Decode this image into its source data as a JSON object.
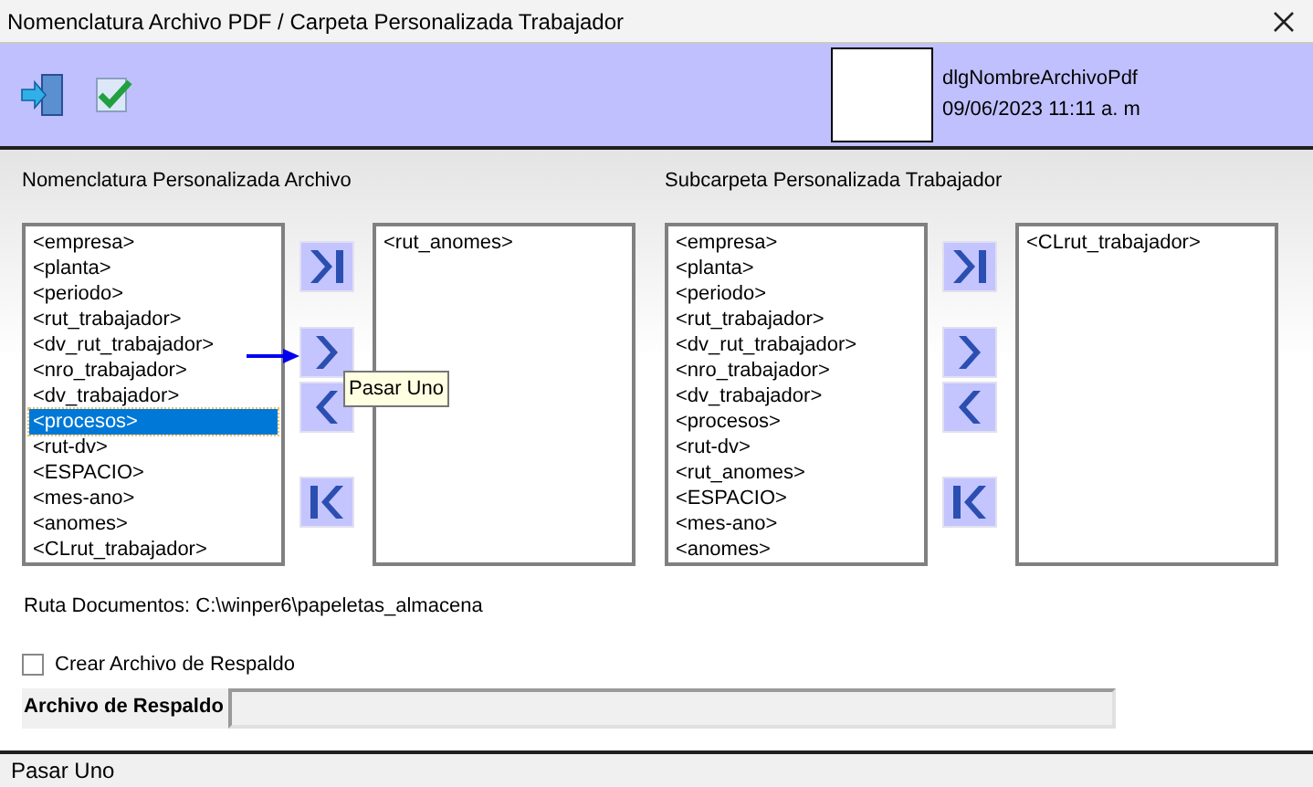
{
  "window": {
    "title": "Nomenclatura Archivo PDF / Carpeta Personalizada Trabajador"
  },
  "header_info": {
    "form_name": "dlgNombreArchivoPdf",
    "timestamp": "09/06/2023 11:11 a. m"
  },
  "groups": [
    {
      "heading": "Nomenclatura Personalizada Archivo",
      "available": [
        {
          "label": "<empresa>",
          "selected": false
        },
        {
          "label": "<planta>",
          "selected": false
        },
        {
          "label": "<periodo>",
          "selected": false
        },
        {
          "label": "<rut_trabajador>",
          "selected": false
        },
        {
          "label": "<dv_rut_trabajador>",
          "selected": false
        },
        {
          "label": "<nro_trabajador>",
          "selected": false
        },
        {
          "label": "<dv_trabajador>",
          "selected": false
        },
        {
          "label": "<procesos>",
          "selected": true
        },
        {
          "label": "<rut-dv>",
          "selected": false
        },
        {
          "label": "<ESPACIO>",
          "selected": false
        },
        {
          "label": "<mes-ano>",
          "selected": false
        },
        {
          "label": "<anomes>",
          "selected": false
        },
        {
          "label": "<CLrut_trabajador>",
          "selected": false
        }
      ],
      "chosen": [
        {
          "label": "<rut_anomes>",
          "selected": false
        }
      ],
      "tooltip": "Pasar Uno"
    },
    {
      "heading": "Subcarpeta Personalizada Trabajador",
      "available": [
        {
          "label": "<empresa>",
          "selected": false
        },
        {
          "label": "<planta>",
          "selected": false
        },
        {
          "label": "<periodo>",
          "selected": false
        },
        {
          "label": "<rut_trabajador>",
          "selected": false
        },
        {
          "label": "<dv_rut_trabajador>",
          "selected": false
        },
        {
          "label": "<nro_trabajador>",
          "selected": false
        },
        {
          "label": "<dv_trabajador>",
          "selected": false
        },
        {
          "label": "<procesos>",
          "selected": false
        },
        {
          "label": "<rut-dv>",
          "selected": false
        },
        {
          "label": "<rut_anomes>",
          "selected": false
        },
        {
          "label": "<ESPACIO>",
          "selected": false
        },
        {
          "label": "<mes-ano>",
          "selected": false
        },
        {
          "label": "<anomes>",
          "selected": false
        }
      ],
      "chosen": [
        {
          "label": "<CLrut_trabajador>",
          "selected": false
        }
      ]
    }
  ],
  "documents_path": "Ruta Documentos: C:\\winper6\\papeletas_almacena",
  "backup_checkbox": {
    "label": "Crear Archivo de Respaldo",
    "checked": false
  },
  "backup_file": {
    "label": "Archivo de Respaldo"
  },
  "status_bar": "Pasar Uno"
}
